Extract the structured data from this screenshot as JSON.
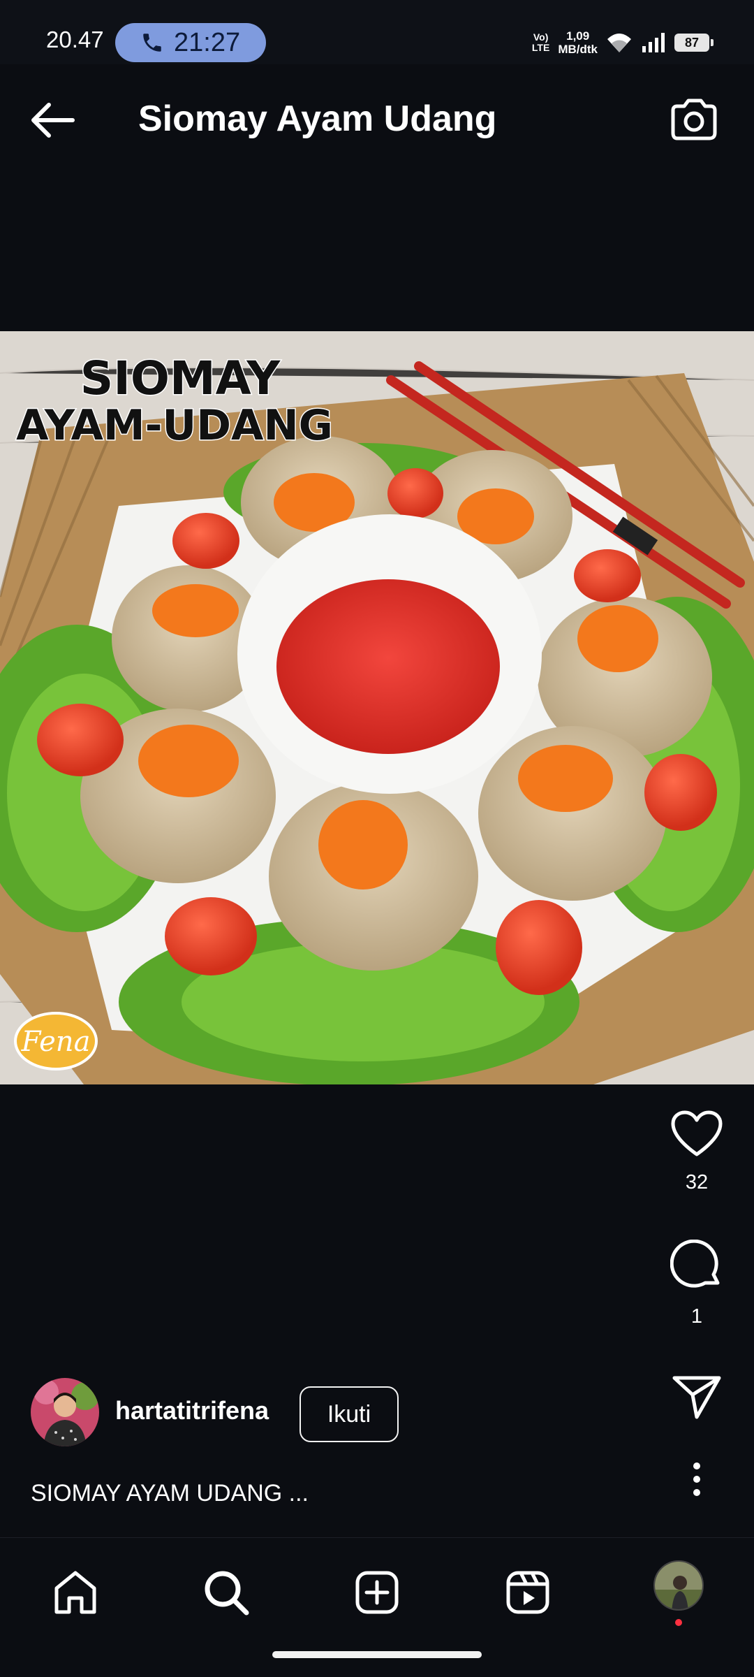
{
  "status_bar": {
    "time": "20.47",
    "call_timer": "21:27",
    "network_line1": "Vo)",
    "network_line2": "LTE",
    "speed_value": "1,09",
    "speed_unit": "MB/dtk",
    "battery": "87"
  },
  "header": {
    "title": "Siomay Ayam Udang",
    "back_icon": "arrow-left-icon",
    "camera_icon": "camera-icon"
  },
  "post": {
    "image_text_line1": "SIOMAY",
    "image_text_line2": "AYAM-UDANG",
    "watermark": "Fena"
  },
  "actions": {
    "likes": "32",
    "comments": "1"
  },
  "author": {
    "username": "hartatitrifena",
    "follow_label": "Ikuti"
  },
  "caption": "SIOMAY AYAM UDANG ...",
  "bottom_nav": {
    "items": [
      "home-icon",
      "search-icon",
      "create-icon",
      "reels-icon",
      "profile-avatar"
    ]
  },
  "colors": {
    "background": "#0b0d12",
    "call_pill": "#7f9bde",
    "notification_dot": "#ff3040"
  }
}
